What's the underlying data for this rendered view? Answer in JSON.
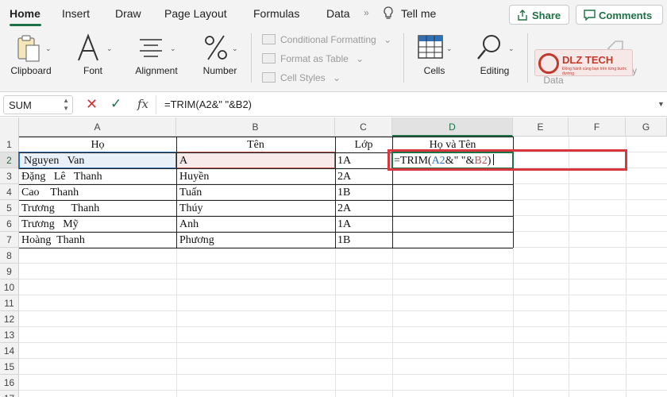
{
  "ribbon_tabs": [
    {
      "label": "Home",
      "active": true
    },
    {
      "label": "Insert"
    },
    {
      "label": "Draw"
    },
    {
      "label": "Page Layout"
    },
    {
      "label": "Formulas"
    },
    {
      "label": "Data"
    }
  ],
  "tell_me": "Tell me",
  "share_label": "Share",
  "comments_label": "Comments",
  "groups": {
    "clipboard": "Clipboard",
    "font": "Font",
    "alignment": "Alignment",
    "number": "Number",
    "conditional_formatting": "Conditional Formatting",
    "format_as_table": "Format as Table",
    "cell_styles": "Cell Styles",
    "cells": "Cells",
    "editing": "Editing",
    "analyse_data": "Analyse Data",
    "sensitivity": "Sensitivity"
  },
  "watermark": {
    "text": "DLZ TECH",
    "subtext": "Đồng hành cùng bạn trên từng bước đường"
  },
  "formula_bar": {
    "name_box": "SUM",
    "formula": "=TRIM(A2&\" \"&B2)"
  },
  "columns": [
    "A",
    "B",
    "C",
    "D",
    "E",
    "F",
    "G"
  ],
  "rows": [
    "1",
    "2",
    "3",
    "4",
    "5",
    "6",
    "7",
    "8",
    "9",
    "10",
    "11",
    "12",
    "13",
    "14",
    "15",
    "16",
    "17"
  ],
  "table": {
    "headers": [
      "Họ",
      "Tên",
      "Lớp",
      "Họ và Tên"
    ],
    "rows": [
      [
        "Nguyen   Van",
        "A",
        "1A"
      ],
      [
        "Đặng   Lê   Thanh",
        "Huyền",
        "2A"
      ],
      [
        "Cao    Thanh",
        "Tuấn",
        "1B"
      ],
      [
        "Trương      Thanh",
        "Thúy",
        "2A"
      ],
      [
        "Trương   Mỹ",
        "Anh",
        "1A"
      ],
      [
        "Hoàng  Thanh",
        "Phương",
        "1B"
      ]
    ]
  },
  "edit_formula_parts": {
    "p1": "=TRIM(",
    "p2": "A2",
    "p3": "&\" \"&",
    "p4": "B2",
    "p5": ")"
  },
  "colors": {
    "accent": "#1e7145",
    "ref_a": "#2f6fb4",
    "ref_b": "#c0504d",
    "highlight": "#d9363e"
  }
}
